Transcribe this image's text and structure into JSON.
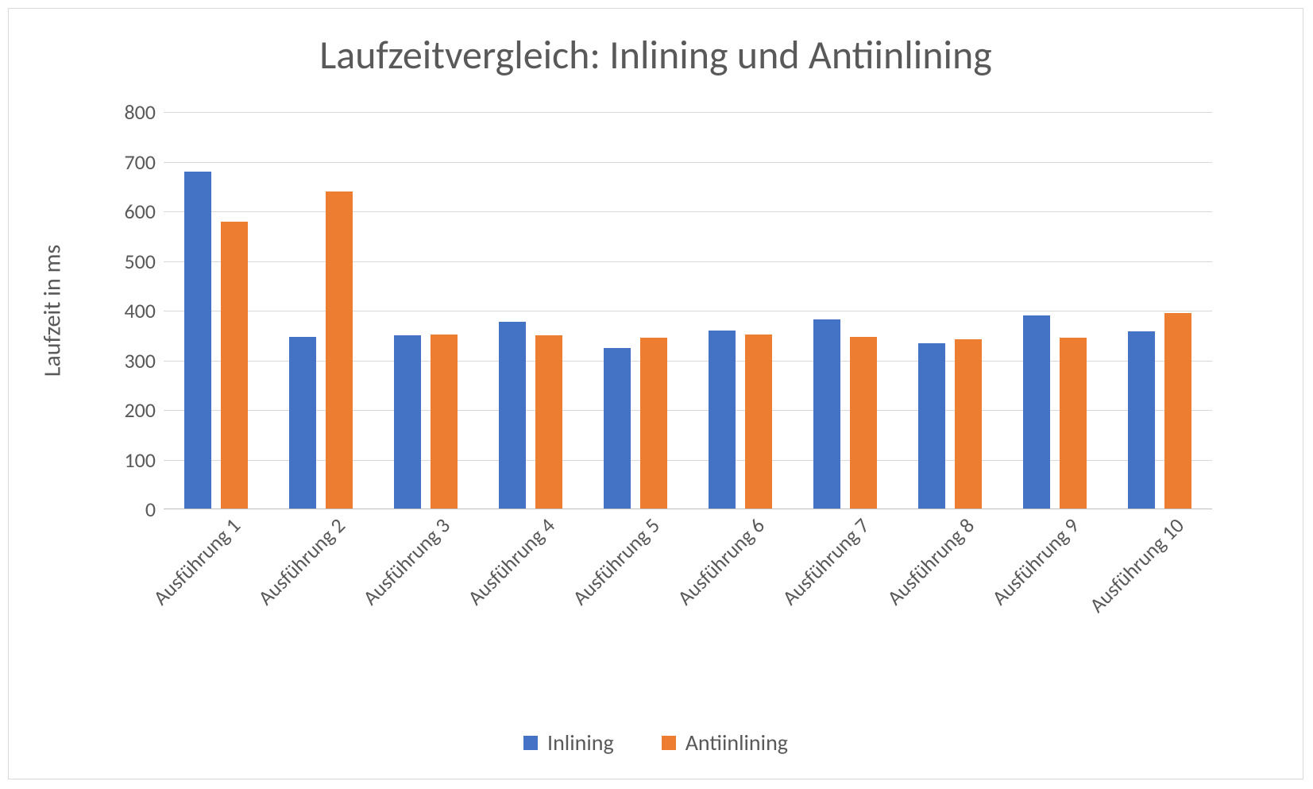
{
  "chart_data": {
    "type": "bar",
    "title": "Laufzeitvergleich: Inlining und Antiinlining",
    "ylabel": "Laufzeit in ms",
    "xlabel": "",
    "ylim": [
      0,
      800
    ],
    "ytick_step": 100,
    "yticks": [
      "0",
      "100",
      "200",
      "300",
      "400",
      "500",
      "600",
      "700",
      "800"
    ],
    "categories": [
      "Ausführung 1",
      "Ausführung 2",
      "Ausführung 3",
      "Ausführung 4",
      "Ausführung 5",
      "Ausführung 6",
      "Ausführung 7",
      "Ausführung 8",
      "Ausführung 9",
      "Ausführung 10"
    ],
    "series": [
      {
        "name": "Inlining",
        "color": "#4472C4",
        "values": [
          680,
          348,
          350,
          378,
          325,
          360,
          383,
          335,
          390,
          358
        ]
      },
      {
        "name": "Antiinlining",
        "color": "#ED7D31",
        "values": [
          580,
          640,
          352,
          350,
          345,
          352,
          348,
          342,
          345,
          395
        ]
      }
    ],
    "legend_position": "bottom",
    "grid": true
  }
}
